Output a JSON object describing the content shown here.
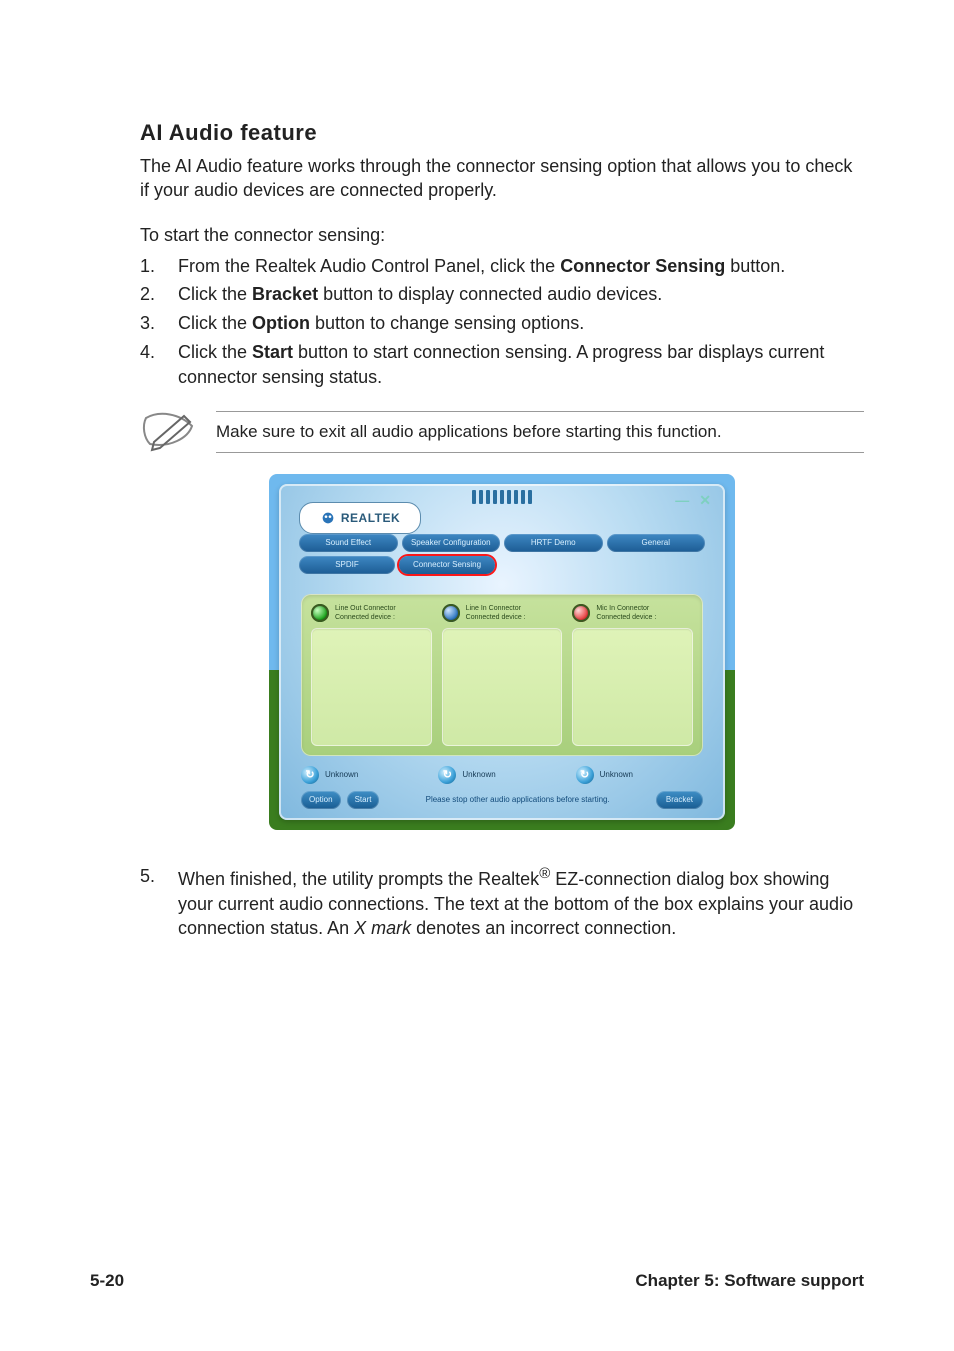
{
  "doc": {
    "section_title": "AI Audio feature",
    "intro": "The AI Audio feature works through the connector sensing option that allows you to check if your audio devices are connected properly.",
    "lead": "To start the connector sensing:",
    "steps": [
      {
        "n": "1.",
        "pre": "From the Realtek Audio Control Panel, click the ",
        "bold": "Connector Sensing",
        "post": " button."
      },
      {
        "n": "2.",
        "pre": "Click the ",
        "bold": "Bracket",
        "post": " button to display connected audio devices."
      },
      {
        "n": "3.",
        "pre": "Click the ",
        "bold": "Option",
        "post": " button to change sensing options."
      },
      {
        "n": "4.",
        "pre": "Click the ",
        "bold": "Start",
        "post": " button to start connection sensing. A progress bar displays current connector sensing status."
      }
    ],
    "note": "Make sure to exit all audio applications before starting this function.",
    "step5": {
      "n": "5.",
      "pre": "When finished, the utility prompts the Realtek",
      "reg": "®",
      "mid": " EZ-connection dialog box showing your current audio connections. The text at the bottom of the box explains your audio connection status. An ",
      "em": "X mark",
      "post": " denotes an incorrect connection."
    },
    "footer_left": "5-20",
    "footer_right": "Chapter 5: Software support"
  },
  "shot": {
    "logo": "REALTEK",
    "win_min": "—",
    "win_close": "✕",
    "tabs_row1": [
      "Sound Effect",
      "Speaker Configuration",
      "HRTF Demo",
      "General"
    ],
    "tabs_row2": [
      "SPDIF",
      "Connector Sensing"
    ],
    "connectors": [
      {
        "title": "Line Out Connector",
        "sub": "Connected device :",
        "jack": "green"
      },
      {
        "title": "Line In Connector",
        "sub": "Connected device :",
        "jack": "blue"
      },
      {
        "title": "Mic In Connector",
        "sub": "Connected device :",
        "jack": "pink"
      }
    ],
    "unknown_label": "Unknown",
    "btn_option": "Option",
    "btn_start": "Start",
    "bottom_msg": "Please stop other audio applications before starting.",
    "btn_bracket": "Bracket"
  }
}
